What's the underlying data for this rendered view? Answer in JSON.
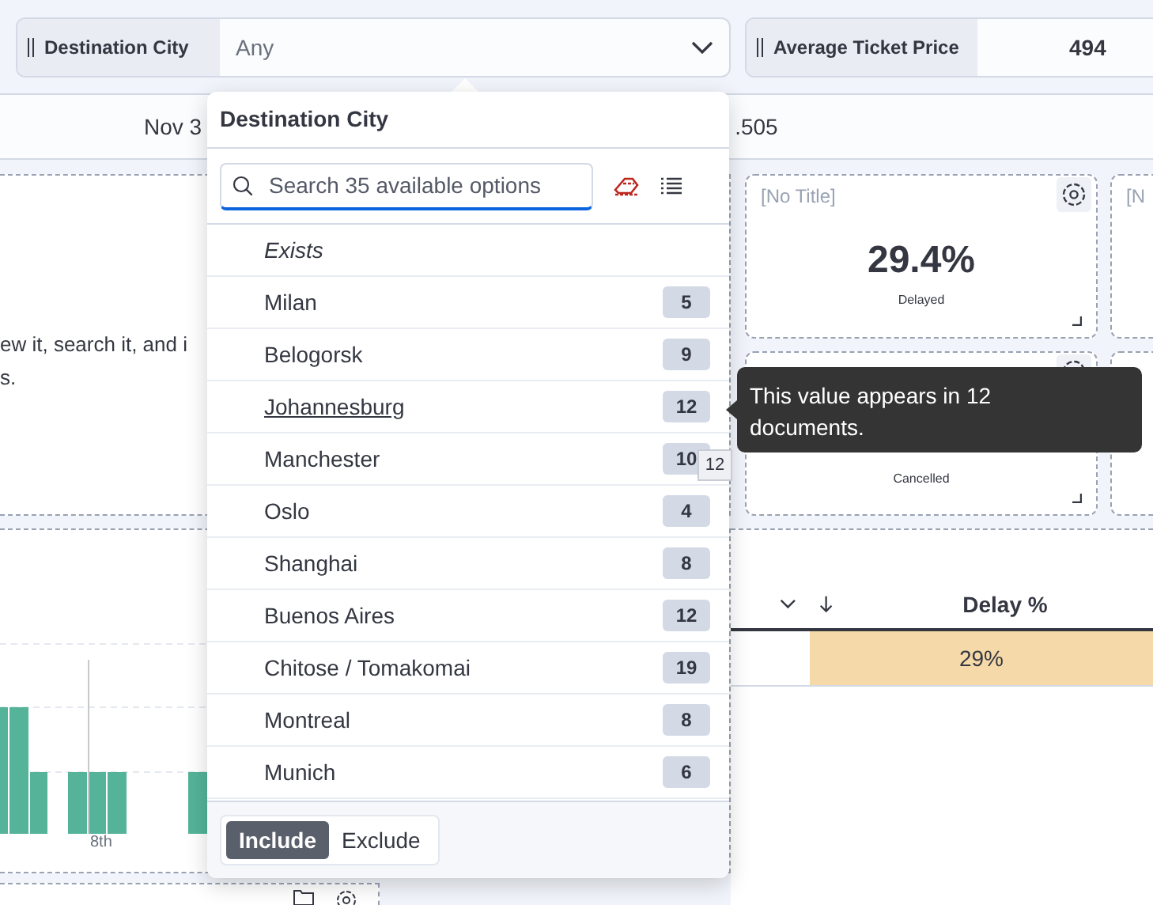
{
  "filters": [
    {
      "label": "Destination City",
      "value": "Any",
      "kind": "select"
    },
    {
      "label": "Average Ticket Price",
      "value": "494",
      "kind": "number"
    }
  ],
  "time_row": {
    "start": "Nov 3",
    "end": ".505"
  },
  "text_panel": {
    "lines": [
      "ew it, search it, and i",
      "s."
    ]
  },
  "metrics": [
    {
      "title": "[No Title]",
      "value": "29.4%",
      "caption": "Delayed",
      "settings": true
    },
    {
      "title": "[N"
    },
    {
      "caption": "Cancelled",
      "settings": true
    }
  ],
  "chart": {
    "x_label": "8th"
  },
  "table": {
    "column": "Delay %",
    "cell": "29%"
  },
  "popover": {
    "title": "Destination City",
    "search": {
      "placeholder": "Search 35 available options"
    },
    "options": [
      {
        "label": "Exists",
        "kind": "exists"
      },
      {
        "label": "Milan",
        "count": "5",
        "kind": "value",
        "hovered": false
      },
      {
        "label": "Belogorsk",
        "count": "9",
        "kind": "value",
        "hovered": false
      },
      {
        "label": "Johannesburg",
        "count": "12",
        "kind": "value",
        "hovered": true
      },
      {
        "label": "Manchester",
        "count": "10",
        "kind": "value",
        "hovered": false
      },
      {
        "label": "Oslo",
        "count": "4",
        "kind": "value",
        "hovered": false
      },
      {
        "label": "Shanghai",
        "count": "8",
        "kind": "value",
        "hovered": false
      },
      {
        "label": "Buenos Aires",
        "count": "12",
        "kind": "value",
        "hovered": false
      },
      {
        "label": "Chitose / Tomakomai",
        "count": "19",
        "kind": "value",
        "hovered": false
      },
      {
        "label": "Montreal",
        "count": "8",
        "kind": "value",
        "hovered": false
      },
      {
        "label": "Munich",
        "count": "6",
        "kind": "value",
        "hovered": false
      }
    ],
    "modes": [
      {
        "label": "Include",
        "selected": true
      },
      {
        "label": "Exclude",
        "selected": false
      }
    ]
  },
  "tooltip": "This value appears in 12 documents.",
  "count_tooltip": "12"
}
